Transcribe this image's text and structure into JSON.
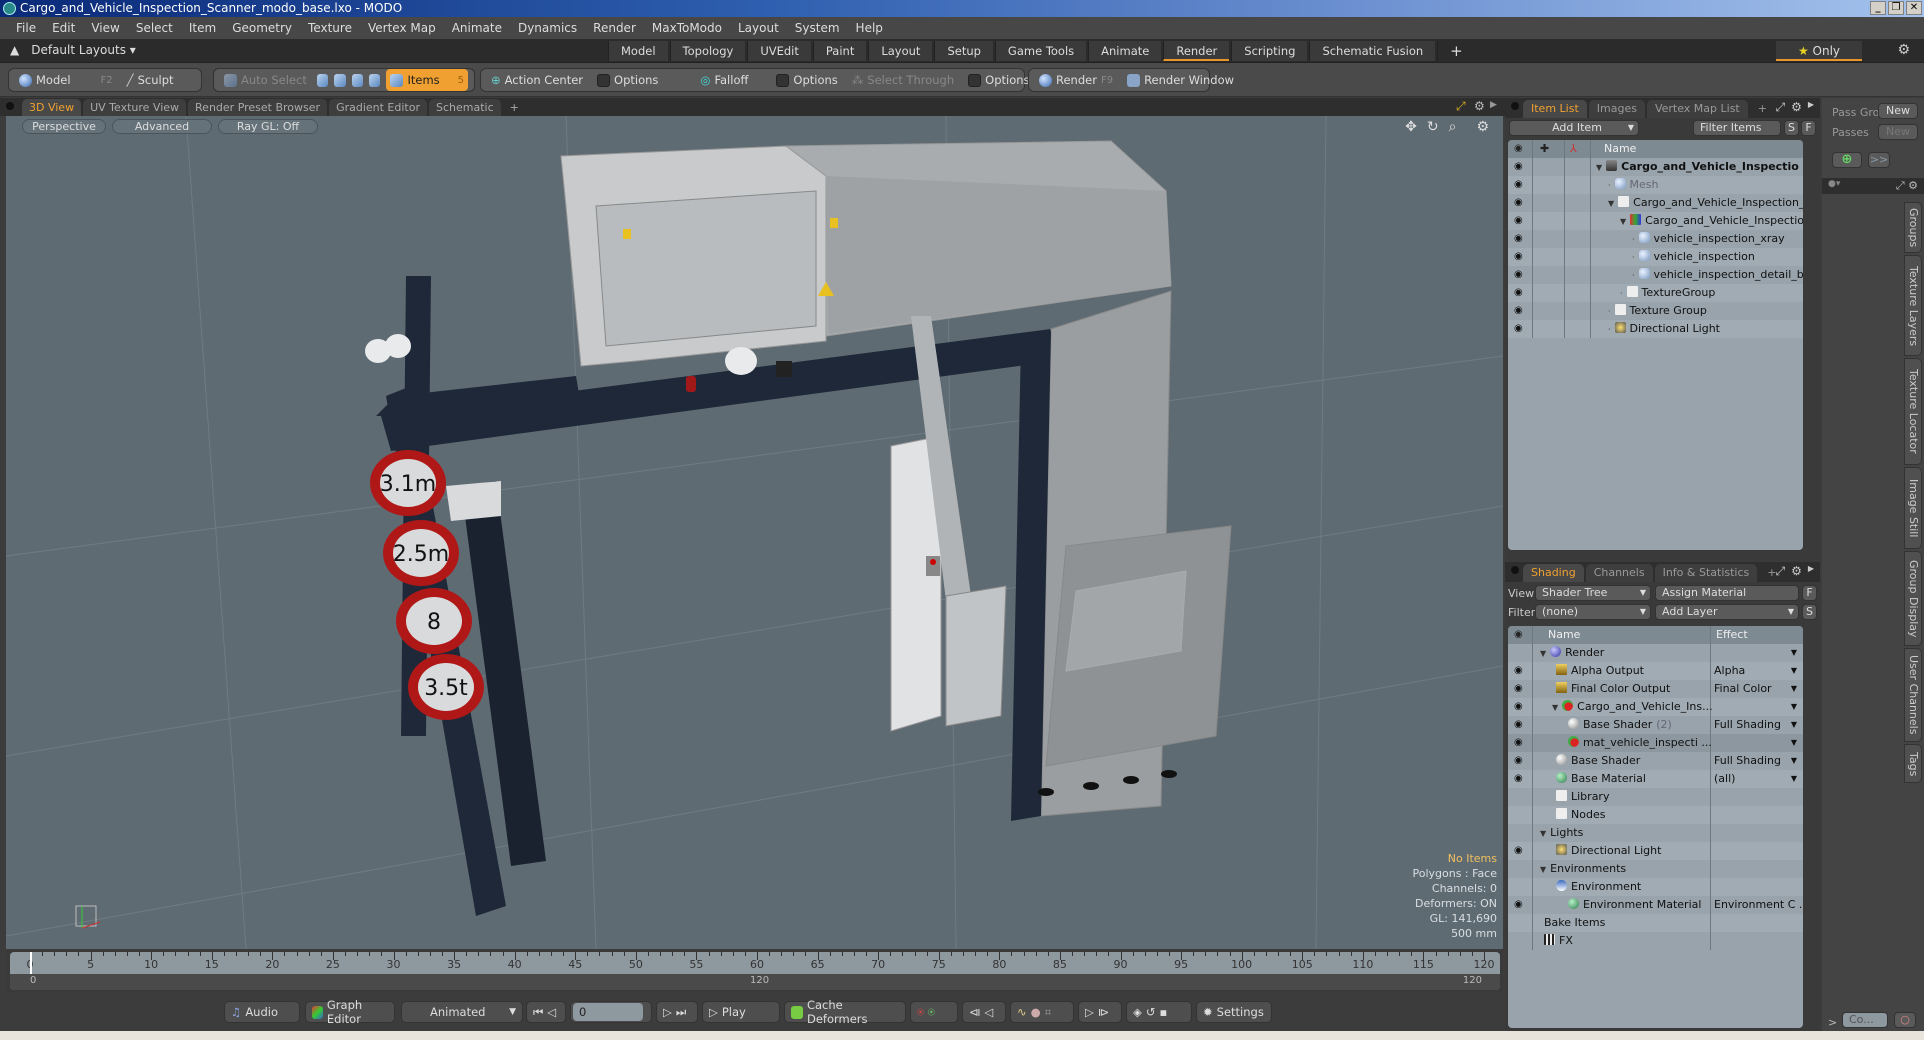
{
  "window": {
    "title": "Cargo_and_Vehicle_Inspection_Scanner_modo_base.lxo - MODO",
    "controls": [
      "_",
      "❐",
      "✕"
    ]
  },
  "menu": [
    "File",
    "Edit",
    "View",
    "Select",
    "Item",
    "Geometry",
    "Texture",
    "Vertex Map",
    "Animate",
    "Dynamics",
    "Render",
    "MaxToModo",
    "Layout",
    "System",
    "Help"
  ],
  "layoutbar": {
    "layouts_dropdown": "Default Layouts ▾",
    "tabs": [
      {
        "label": "Model",
        "active": false
      },
      {
        "label": "Topology",
        "active": false
      },
      {
        "label": "UVEdit",
        "active": false
      },
      {
        "label": "Paint",
        "active": false
      },
      {
        "label": "Layout",
        "active": false
      },
      {
        "label": "Setup",
        "active": false
      },
      {
        "label": "Game Tools",
        "active": false
      },
      {
        "label": "Animate",
        "active": false
      },
      {
        "label": "Render",
        "active": true
      },
      {
        "label": "Scripting",
        "active": false
      },
      {
        "label": "Schematic Fusion",
        "active": false
      }
    ],
    "add_tab": "+",
    "only_label": "Only"
  },
  "toolbar": {
    "model": "Model",
    "model_key": "F2",
    "sculpt": "Sculpt",
    "auto_select": "Auto Select",
    "items": "Items",
    "items_key": "5",
    "action_center": "Action Center",
    "options1": "Options",
    "falloff": "Falloff",
    "options2": "Options",
    "select_through": "Select Through",
    "options3": "Options",
    "render": "Render",
    "render_key": "F9",
    "render_window": "Render Window"
  },
  "viewport_tabs": [
    {
      "label": "3D View",
      "active": true
    },
    {
      "label": "UV Texture View",
      "active": false
    },
    {
      "label": "Render Preset Browser",
      "active": false
    },
    {
      "label": "Gradient Editor",
      "active": false
    },
    {
      "label": "Schematic",
      "active": false
    }
  ],
  "viewport": {
    "perspective": "Perspective",
    "advanced": "Advanced",
    "raygl": "Ray GL: Off",
    "signs": [
      "3.1m",
      "2.5m",
      "8",
      "3.5t"
    ],
    "info": {
      "selection": "No Items",
      "polygons": "Polygons : Face",
      "channels": "Channels: 0",
      "deformers": "Deformers: ON",
      "gl": "GL: 141,690",
      "scale": "500 mm"
    }
  },
  "timeline": {
    "start": 0,
    "end": 120,
    "step": 5,
    "range_start_label": "0",
    "range_end_label": "120",
    "mid_label": "120"
  },
  "bottombar": {
    "audio": "Audio",
    "graph_editor": "Graph Editor",
    "animated": "Animated",
    "current_frame": "0",
    "play": "Play",
    "cache_deformers": "Cache Deformers",
    "settings": "Settings"
  },
  "item_list": {
    "tabs": [
      {
        "label": "Item List",
        "active": true
      },
      {
        "label": "Images",
        "active": false
      },
      {
        "label": "Vertex Map List",
        "active": false
      }
    ],
    "add_item": "Add Item",
    "filter_items": "Filter Items",
    "s_btn": "S",
    "f_btn": "F",
    "column_name": "Name",
    "rows": [
      {
        "name": "Cargo_and_Vehicle_Inspectio ...",
        "indent": 0,
        "icon": "scene",
        "bold": true,
        "expanded": true
      },
      {
        "name": "Mesh",
        "indent": 1,
        "icon": "mesh",
        "dim": true
      },
      {
        "name": "Cargo_and_Vehicle_Inspection_ ...",
        "indent": 1,
        "icon": "folder",
        "expanded": true
      },
      {
        "name": "Cargo_and_Vehicle_Inspectio ...",
        "indent": 2,
        "icon": "locator",
        "expanded": true
      },
      {
        "name": "vehicle_inspection_xray",
        "indent": 3,
        "icon": "mesh"
      },
      {
        "name": "vehicle_inspection",
        "indent": 3,
        "icon": "mesh"
      },
      {
        "name": "vehicle_inspection_detail_b ...",
        "indent": 3,
        "icon": "mesh"
      },
      {
        "name": "TextureGroup",
        "indent": 2,
        "icon": "folder"
      },
      {
        "name": "Texture Group",
        "indent": 1,
        "icon": "folder"
      },
      {
        "name": "Directional Light",
        "indent": 1,
        "icon": "light"
      }
    ]
  },
  "shading": {
    "tabs": [
      {
        "label": "Shading",
        "active": true
      },
      {
        "label": "Channels",
        "active": false
      },
      {
        "label": "Info & Statistics",
        "active": false
      }
    ],
    "view_label": "View",
    "view_value": "Shader Tree",
    "assign_material": "Assign Material",
    "f_btn": "F",
    "filter_label": "Filter",
    "filter_value": "(none)",
    "add_layer": "Add Layer",
    "s_btn": "S",
    "col_name": "Name",
    "col_effect": "Effect",
    "rows": [
      {
        "name": "Render",
        "indent": 0,
        "icon": "render",
        "effect": "",
        "eye": false,
        "expanded": true
      },
      {
        "name": "Alpha Output",
        "indent": 1,
        "icon": "output",
        "effect": "Alpha",
        "eye": true
      },
      {
        "name": "Final Color Output",
        "indent": 1,
        "icon": "output",
        "effect": "Final Color",
        "eye": true
      },
      {
        "name": "Cargo_and_Vehicle_Ins...",
        "indent": 1,
        "icon": "material-group",
        "effect": "",
        "eye": true,
        "expanded": true
      },
      {
        "name": "Base Shader",
        "suffix": "(2)",
        "indent": 2,
        "icon": "shader",
        "effect": "Full Shading",
        "eye": true
      },
      {
        "name": "mat_vehicle_inspecti ...",
        "indent": 2,
        "icon": "material-group",
        "effect": "",
        "eye": true,
        "selected": true
      },
      {
        "name": "Base Shader",
        "indent": 1,
        "icon": "shader",
        "effect": "Full Shading",
        "eye": true
      },
      {
        "name": "Base Material",
        "indent": 1,
        "icon": "material",
        "effect": "(all)",
        "eye": true
      },
      {
        "name": "Library",
        "indent": 1,
        "icon": "folder",
        "effect": "",
        "eye": false,
        "noarrow": true
      },
      {
        "name": "Nodes",
        "indent": 1,
        "icon": "folder",
        "effect": "",
        "eye": false,
        "noarrow": true
      },
      {
        "name": "Lights",
        "indent": 0,
        "icon": "none",
        "effect": "",
        "eye": false,
        "expanded": true,
        "noarrow": true
      },
      {
        "name": "Directional Light",
        "indent": 1,
        "icon": "light",
        "effect": "",
        "eye": true,
        "noarrow": true
      },
      {
        "name": "Environments",
        "indent": 0,
        "icon": "none",
        "effect": "",
        "eye": false,
        "expanded": true,
        "noarrow": true
      },
      {
        "name": "Environment",
        "indent": 1,
        "icon": "environment",
        "effect": "",
        "eye": false,
        "noarrow": true
      },
      {
        "name": "Environment Material",
        "indent": 2,
        "icon": "material",
        "effect": "Environment C ...",
        "eye": true,
        "noarrow": true
      },
      {
        "name": "Bake Items",
        "indent": 0,
        "icon": "none",
        "effect": "",
        "eye": false,
        "noarrow": true
      },
      {
        "name": "FX",
        "indent": 0,
        "icon": "fx",
        "effect": "",
        "eye": false,
        "noarrow": true
      }
    ]
  },
  "passes": {
    "pass_groups": "Pass Gro",
    "passes": "Passes",
    "new1": "New",
    "new2": "New",
    "more": ">>",
    "side_tabs": [
      "Groups",
      "Texture Layers",
      "Texture Locator",
      "Image Still",
      "Group Display",
      "User Channels",
      "Tags"
    ],
    "command_prompt": ">",
    "command_placeholder": "Co..."
  },
  "colors": {
    "accent": "#f0a030",
    "viewport_bg": "#5f6b73",
    "frame_navy": "#1e2838",
    "sign_red": "#b01818"
  }
}
